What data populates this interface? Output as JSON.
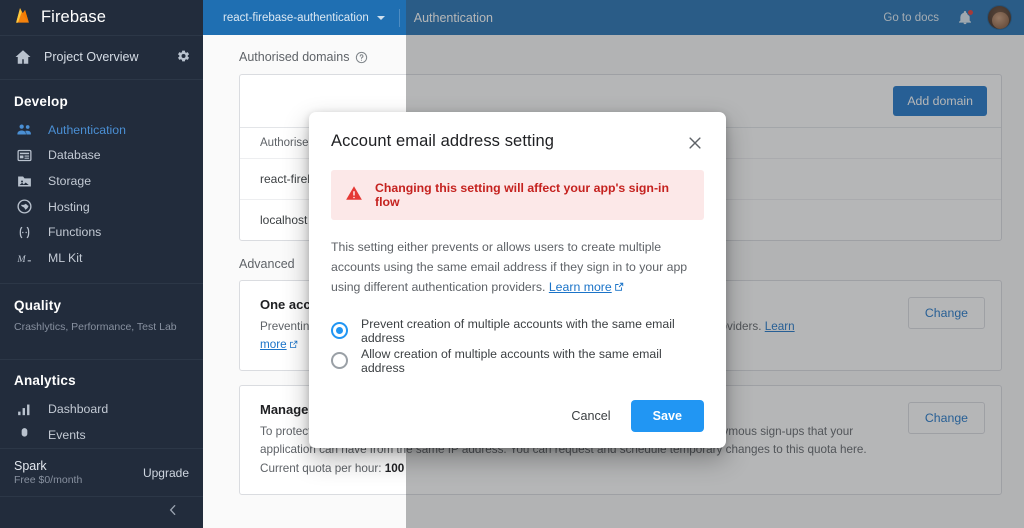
{
  "sidebar": {
    "brand": "Firebase",
    "overview": "Project Overview",
    "settings_icon": "gear-icon",
    "develop": {
      "title": "Develop",
      "items": [
        {
          "label": "Authentication",
          "icon": "users-icon",
          "active": true
        },
        {
          "label": "Database",
          "icon": "database-icon",
          "active": false
        },
        {
          "label": "Storage",
          "icon": "folder-image-icon",
          "active": false
        },
        {
          "label": "Hosting",
          "icon": "globe-icon",
          "active": false
        },
        {
          "label": "Functions",
          "icon": "functions-icon",
          "active": false
        },
        {
          "label": "ML Kit",
          "icon": "ml-kit-icon",
          "active": false
        }
      ]
    },
    "quality": {
      "title": "Quality",
      "subtitle": "Crashlytics, Performance, Test Lab"
    },
    "analytics": {
      "title": "Analytics",
      "items": [
        {
          "label": "Dashboard",
          "icon": "bar-chart-icon"
        },
        {
          "label": "Events",
          "icon": "events-icon"
        }
      ]
    },
    "plan": {
      "name": "Spark",
      "price": "Free $0/month",
      "upgrade": "Upgrade"
    },
    "collapse_icon": "chevron-left-icon"
  },
  "topbar": {
    "project": "react-firebase-authentication",
    "dropdown_icon": "chevron-down-icon",
    "section": "Authentication",
    "docs": "Go to docs",
    "bell_icon": "notifications-bell-icon",
    "avatar": "user-avatar"
  },
  "main": {
    "authorised_domains": {
      "heading": "Authorised domains",
      "help_icon": "help-circle-icon",
      "add_button": "Add domain",
      "column_header": "Authorised",
      "rows": [
        "react-fireb",
        "localhost"
      ]
    },
    "advanced_label": "Advanced",
    "cards": [
      {
        "title": "One acc",
        "body_prefix": "Preventin",
        "body_suffix": "t authentication providers.",
        "link_text": "Learn",
        "link_text2": "more",
        "external_icon": "external-link-icon",
        "action": "Change"
      },
      {
        "title": "Manage sign-up quota",
        "body": "To protect your project from abuse, we limit the number of new Email/Password and Anonymous sign-ups that your application can have from the same IP address. You can request and schedule temporary changes to this quota here.",
        "quota_label": "Current quota per hour:",
        "quota_value": "100",
        "action": "Change"
      }
    ]
  },
  "modal": {
    "title": "Account email address setting",
    "close_icon": "close-icon",
    "warning_icon": "warning-triangle-icon",
    "warning": "Changing this setting will affect your app's sign-in flow",
    "description": "This setting either prevents or allows users to create multiple accounts using the same email address if they sign in to your app using different authentication providers.",
    "learn_more": "Learn more",
    "learn_more_icon": "external-link-icon",
    "options": [
      {
        "label": "Prevent creation of multiple accounts with the same email address",
        "selected": true
      },
      {
        "label": "Allow creation of multiple accounts with the same email address",
        "selected": false
      }
    ],
    "cancel": "Cancel",
    "save": "Save"
  },
  "colors": {
    "sidebar_bg": "#222c3c",
    "topbar_blue": "#1f6fb2",
    "accent_blue": "#1a73c8",
    "save_blue": "#2196f3",
    "warning_bg": "#fce8e8",
    "warning_text": "#c5221f",
    "link": "#1a73c8"
  }
}
